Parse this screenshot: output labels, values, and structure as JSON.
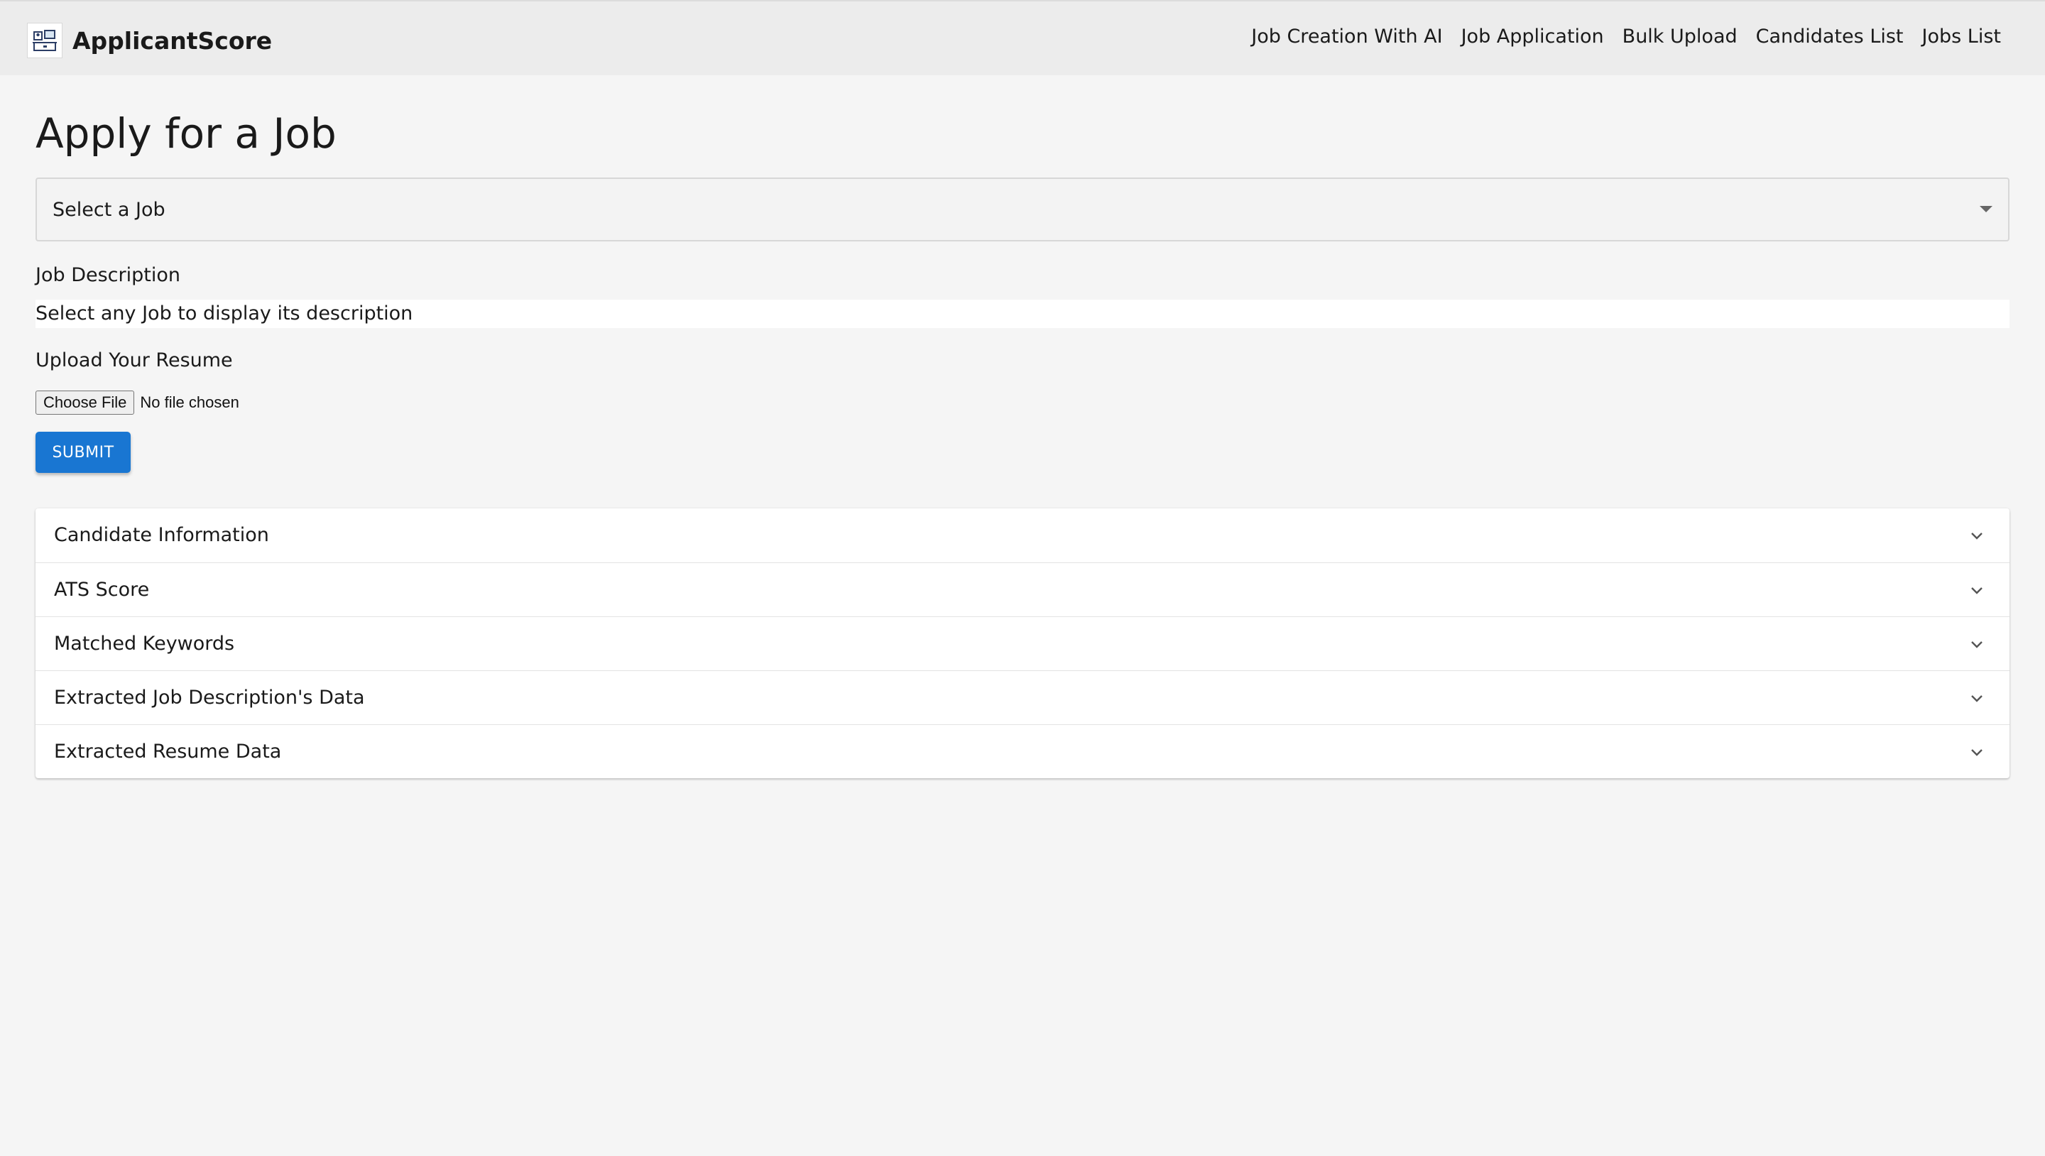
{
  "brand": {
    "name": "ApplicantScore",
    "logo_icon": "office-desk-icon"
  },
  "nav": {
    "links": [
      {
        "label": "Job Creation With AI"
      },
      {
        "label": "Job Application"
      },
      {
        "label": "Bulk Upload"
      },
      {
        "label": "Candidates List"
      },
      {
        "label": "Jobs List"
      }
    ]
  },
  "page": {
    "title": "Apply for a Job"
  },
  "job_select": {
    "selected": "Select a Job",
    "icon": "caret-down-icon"
  },
  "job_description": {
    "label": "Job Description",
    "text": "Select any Job to display its description"
  },
  "resume_upload": {
    "label": "Upload Your Resume",
    "button_label": "Choose File",
    "status": "No file chosen"
  },
  "submit": {
    "label": "SUBMIT",
    "color": "#1976d2"
  },
  "accordion": {
    "items": [
      {
        "title": "Candidate Information"
      },
      {
        "title": "ATS Score"
      },
      {
        "title": "Matched Keywords"
      },
      {
        "title": "Extracted Job Description's Data"
      },
      {
        "title": "Extracted Resume Data"
      }
    ],
    "icon": "chevron-down-icon"
  }
}
